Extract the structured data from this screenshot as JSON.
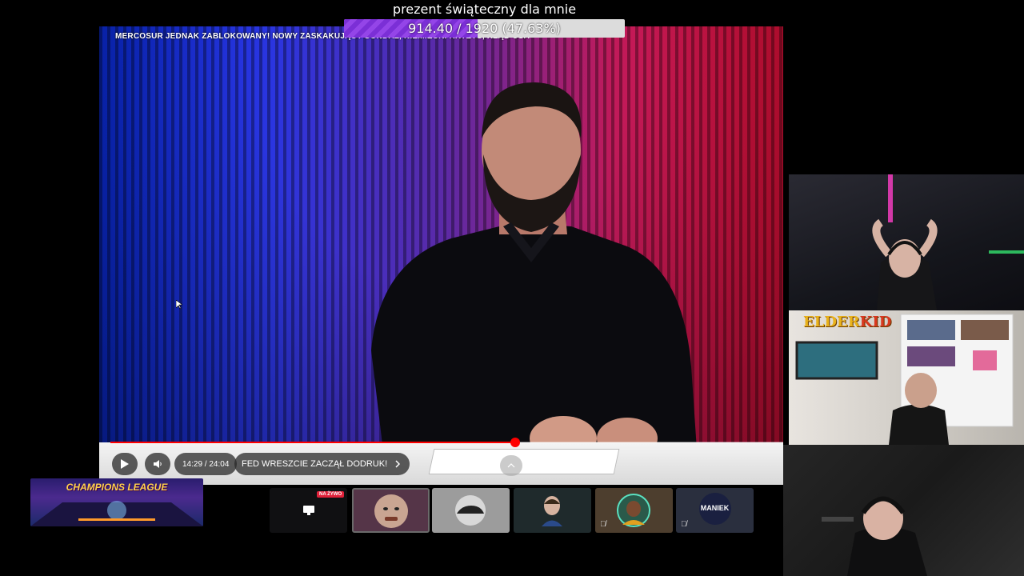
{
  "goal": {
    "title": "prezent świąteczny dla mnie",
    "progress_text": "914.40 / 1920 (47.63%)",
    "current": 914.4,
    "target": 1920,
    "fraction": 0.4763,
    "fill_color": "#8a3ce0"
  },
  "video": {
    "title": "MERCOSUR JEDNAK ZABLOKOWANY! NOWY ZASKAKUJĄCY SONDAŻ, NIEMIECKI KRYZYS, RZĄD USA",
    "time": "14:29 / 24:04",
    "played_fraction": 0.602,
    "chapter": "FED WRESZCIE ZACZĄŁ DODRUK!",
    "progress_color": "#ff0000",
    "play_icon": "play-icon",
    "volume_icon": "volume-icon",
    "chapter_icon": "chevron-right-icon",
    "expand_icon": "chevron-up-icon"
  },
  "overlay": {
    "elder_logo_a": "ELDER",
    "elder_logo_b": "KID",
    "champions_label": "CHAMPIONS LEAGUE"
  },
  "participants": {
    "live_badge": "NA ŻYWO",
    "tile5_name": "MANIEK"
  }
}
